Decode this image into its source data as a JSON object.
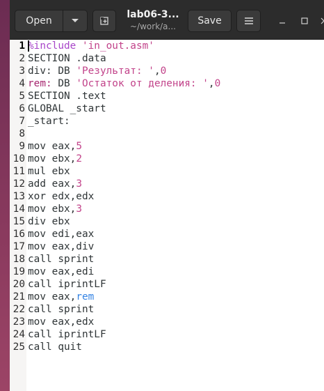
{
  "header": {
    "open_label": "Open",
    "open_arrow_icon": "chevron-down-icon",
    "new_tab_icon": "new-tab-icon",
    "title": "lab06-3...",
    "subtitle": "~/work/a...",
    "save_label": "Save",
    "menu_icon": "hamburger-menu-icon",
    "window_controls": [
      "minimize-icon",
      "maximize-icon",
      "close-icon"
    ]
  },
  "editor": {
    "lines": [
      {
        "n": "1",
        "tokens": [
          {
            "t": "%include ",
            "c": "pre"
          },
          {
            "t": "'in_out.asm'",
            "c": "str"
          }
        ]
      },
      {
        "n": "2",
        "tokens": [
          {
            "t": "SECTION .data",
            "c": "plain"
          }
        ]
      },
      {
        "n": "3",
        "tokens": [
          {
            "t": "div:",
            "c": "plain"
          },
          {
            "t": " DB ",
            "c": "plain"
          },
          {
            "t": "'Результат: '",
            "c": "str"
          },
          {
            "t": ",",
            "c": "plain"
          },
          {
            "t": "0",
            "c": "num"
          }
        ]
      },
      {
        "n": "4",
        "tokens": [
          {
            "t": "rem:",
            "c": "label"
          },
          {
            "t": " DB ",
            "c": "plain"
          },
          {
            "t": "'Остаток от деления: '",
            "c": "str"
          },
          {
            "t": ",",
            "c": "plain"
          },
          {
            "t": "0",
            "c": "num"
          }
        ]
      },
      {
        "n": "5",
        "tokens": [
          {
            "t": "SECTION .text",
            "c": "plain"
          }
        ]
      },
      {
        "n": "6",
        "tokens": [
          {
            "t": "GLOBAL _start",
            "c": "plain"
          }
        ]
      },
      {
        "n": "7",
        "tokens": [
          {
            "t": "_start:",
            "c": "plain"
          }
        ]
      },
      {
        "n": "8",
        "tokens": []
      },
      {
        "n": "9",
        "tokens": [
          {
            "t": "mov eax,",
            "c": "plain"
          },
          {
            "t": "5",
            "c": "num"
          }
        ]
      },
      {
        "n": "10",
        "tokens": [
          {
            "t": "mov ebx,",
            "c": "plain"
          },
          {
            "t": "2",
            "c": "num"
          }
        ]
      },
      {
        "n": "11",
        "tokens": [
          {
            "t": "mul ebx",
            "c": "plain"
          }
        ]
      },
      {
        "n": "12",
        "tokens": [
          {
            "t": "add eax,",
            "c": "plain"
          },
          {
            "t": "3",
            "c": "num"
          }
        ]
      },
      {
        "n": "13",
        "tokens": [
          {
            "t": "xor edx,edx",
            "c": "plain"
          }
        ]
      },
      {
        "n": "14",
        "tokens": [
          {
            "t": "mov ebx,",
            "c": "plain"
          },
          {
            "t": "3",
            "c": "num"
          }
        ]
      },
      {
        "n": "15",
        "tokens": [
          {
            "t": "div ebx",
            "c": "plain"
          }
        ]
      },
      {
        "n": "16",
        "tokens": [
          {
            "t": "mov edi,eax",
            "c": "plain"
          }
        ]
      },
      {
        "n": "17",
        "tokens": [
          {
            "t": "mov eax,div",
            "c": "plain"
          }
        ]
      },
      {
        "n": "18",
        "tokens": [
          {
            "t": "call sprint",
            "c": "plain"
          }
        ]
      },
      {
        "n": "19",
        "tokens": [
          {
            "t": "mov eax,edi",
            "c": "plain"
          }
        ]
      },
      {
        "n": "20",
        "tokens": [
          {
            "t": "call iprintLF",
            "c": "plain"
          }
        ]
      },
      {
        "n": "21",
        "tokens": [
          {
            "t": "mov eax,",
            "c": "plain"
          },
          {
            "t": "rem",
            "c": "reg"
          }
        ]
      },
      {
        "n": "22",
        "tokens": [
          {
            "t": "call sprint",
            "c": "plain"
          }
        ]
      },
      {
        "n": "23",
        "tokens": [
          {
            "t": "mov eax,edx",
            "c": "plain"
          }
        ]
      },
      {
        "n": "24",
        "tokens": [
          {
            "t": "call iprintLF",
            "c": "plain"
          }
        ]
      },
      {
        "n": "25",
        "tokens": [
          {
            "t": "call quit",
            "c": "plain"
          }
        ]
      }
    ],
    "current_line": "1"
  },
  "colors": {
    "preprocessor": "#a846c9",
    "string": "#c2438a",
    "label": "#a7266f",
    "register": "#3584e4",
    "text": "#2e3436",
    "headerbar": "#2c2c2c"
  }
}
